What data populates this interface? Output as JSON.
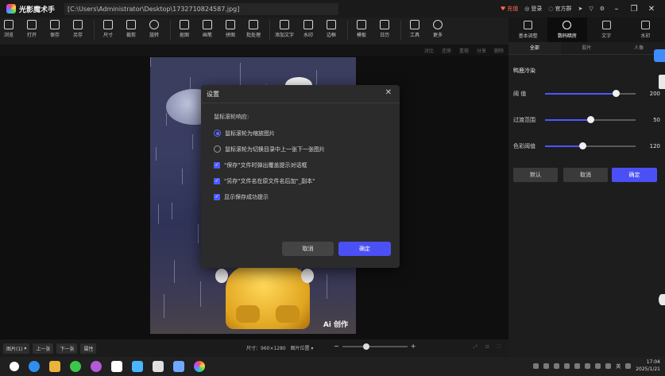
{
  "app": {
    "name": "光影魔术手",
    "file_path": "[C:\\Users\\Administrator\\Desktop\\1732710824587.jpg]"
  },
  "titlebar": {
    "vip_label": "充值",
    "login_label": "登录",
    "assistant_label": "官方群"
  },
  "toolbar": {
    "items": [
      {
        "label": "浏览",
        "icon": "browse-icon"
      },
      {
        "label": "打开",
        "icon": "open-icon"
      },
      {
        "label": "保存",
        "icon": "save-icon"
      },
      {
        "label": "另存",
        "icon": "save-as-icon"
      },
      {
        "label": "尺寸",
        "icon": "resize-icon"
      },
      {
        "label": "裁剪",
        "icon": "crop-icon"
      },
      {
        "label": "旋转",
        "icon": "rotate-icon"
      },
      {
        "label": "抠图",
        "icon": "cutout-icon"
      },
      {
        "label": "画笔",
        "icon": "brush-icon"
      },
      {
        "label": "拼图",
        "icon": "collage-icon"
      },
      {
        "label": "批处理",
        "icon": "batch-icon"
      },
      {
        "label": "添加文字",
        "icon": "text-icon"
      },
      {
        "label": "水印",
        "icon": "watermark-icon"
      },
      {
        "label": "边框",
        "icon": "frame-icon"
      },
      {
        "label": "模板",
        "icon": "template-icon"
      },
      {
        "label": "日历",
        "icon": "calendar-icon"
      },
      {
        "label": "工具",
        "icon": "tools-icon"
      },
      {
        "label": "更多",
        "icon": "more-icon"
      }
    ]
  },
  "subbar": {
    "actions": [
      "对比",
      "还原",
      "重做",
      "分享",
      "删除"
    ]
  },
  "dialog": {
    "title": "设置",
    "wheel_question": "鼠标滚轮响应:",
    "radio_zoom": "鼠标滚轮为缩放图片",
    "radio_nav": "鼠标滚轮为切换目录中上一张下一张图片",
    "check_overwrite": "\"保存\"文件时弹出覆盖提示对话框",
    "check_suffix": "\"另存\"文件名在原文件名后加\"_副本\"",
    "check_success": "显示保存成功提示",
    "cancel": "取消",
    "ok": "确定"
  },
  "canvas": {
    "watermark": "Ai 创作"
  },
  "bottombar": {
    "browse": "图片(1)",
    "prev": "上一张",
    "next": "下一张",
    "props": "属性",
    "size_label": "尺寸：960×1280",
    "image_position": "图片位置"
  },
  "rpanel": {
    "tabs": [
      {
        "label": "基本调整",
        "icon": "adjust-icon"
      },
      {
        "label": "数码暗房",
        "icon": "darkroom-icon"
      },
      {
        "label": "文字",
        "icon": "text-icon"
      },
      {
        "label": "水印",
        "icon": "watermark-icon"
      }
    ],
    "subtabs": [
      "全部",
      "胶片",
      "人像"
    ],
    "effect_title": "鸭鹿冷染",
    "sliders": [
      {
        "label": "阈  值",
        "value": 200,
        "fraction": 0.78
      },
      {
        "label": "过渡范围",
        "value": 50,
        "fraction": 0.5
      },
      {
        "label": "色彩阈值",
        "value": 120,
        "fraction": 0.41
      }
    ],
    "buttons": {
      "default": "默认",
      "cancel": "取消",
      "ok": "确定"
    }
  },
  "taskbar": {
    "time": "17:04",
    "date": "2025/1/21",
    "ime": "英"
  },
  "colors": {
    "accent": "#4b50f5",
    "radio": "#5b6cff"
  }
}
